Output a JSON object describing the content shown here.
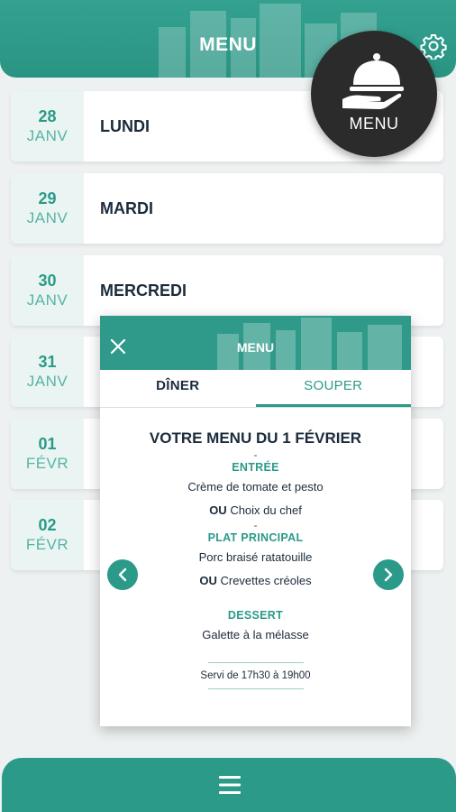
{
  "header": {
    "title": "MENU"
  },
  "fab": {
    "label": "MENU"
  },
  "days": [
    {
      "num": "28",
      "month": "JANV",
      "name": "LUNDI"
    },
    {
      "num": "29",
      "month": "JANV",
      "name": "MARDI"
    },
    {
      "num": "30",
      "month": "JANV",
      "name": "MERCREDI"
    },
    {
      "num": "31",
      "month": "JANV",
      "name": ""
    },
    {
      "num": "01",
      "month": "FÉVR",
      "name": ""
    },
    {
      "num": "02",
      "month": "FÉVR",
      "name": ""
    }
  ],
  "modal": {
    "title": "MENU",
    "tabs": {
      "diner": "DÎNER",
      "souper": "SOUPER"
    },
    "heading": "VOTRE MENU DU 1 FÉVRIER",
    "dash": "-",
    "entree_label": "ENTRÉE",
    "entree_1": "Crème de tomate et pesto",
    "ou": "OU",
    "entree_2": "Choix du chef",
    "main_label": "PLAT PRINCIPAL",
    "main_1": "Porc braisé ratatouille",
    "main_2": "Crevettes créoles",
    "dessert_label": "DESSERT",
    "dessert_1": "Galette à la mélasse",
    "served": "Servi de 17h30 à 19h00"
  },
  "colors": {
    "accent": "#2b9a88",
    "fab": "#2b2b2b",
    "text": "#1c2b3b"
  },
  "icons": {
    "settings": "gear-icon",
    "fab": "cloche-serving-icon",
    "close": "close-icon",
    "prev": "chevron-left-icon",
    "next": "chevron-right-icon",
    "nav": "hamburger-icon"
  }
}
